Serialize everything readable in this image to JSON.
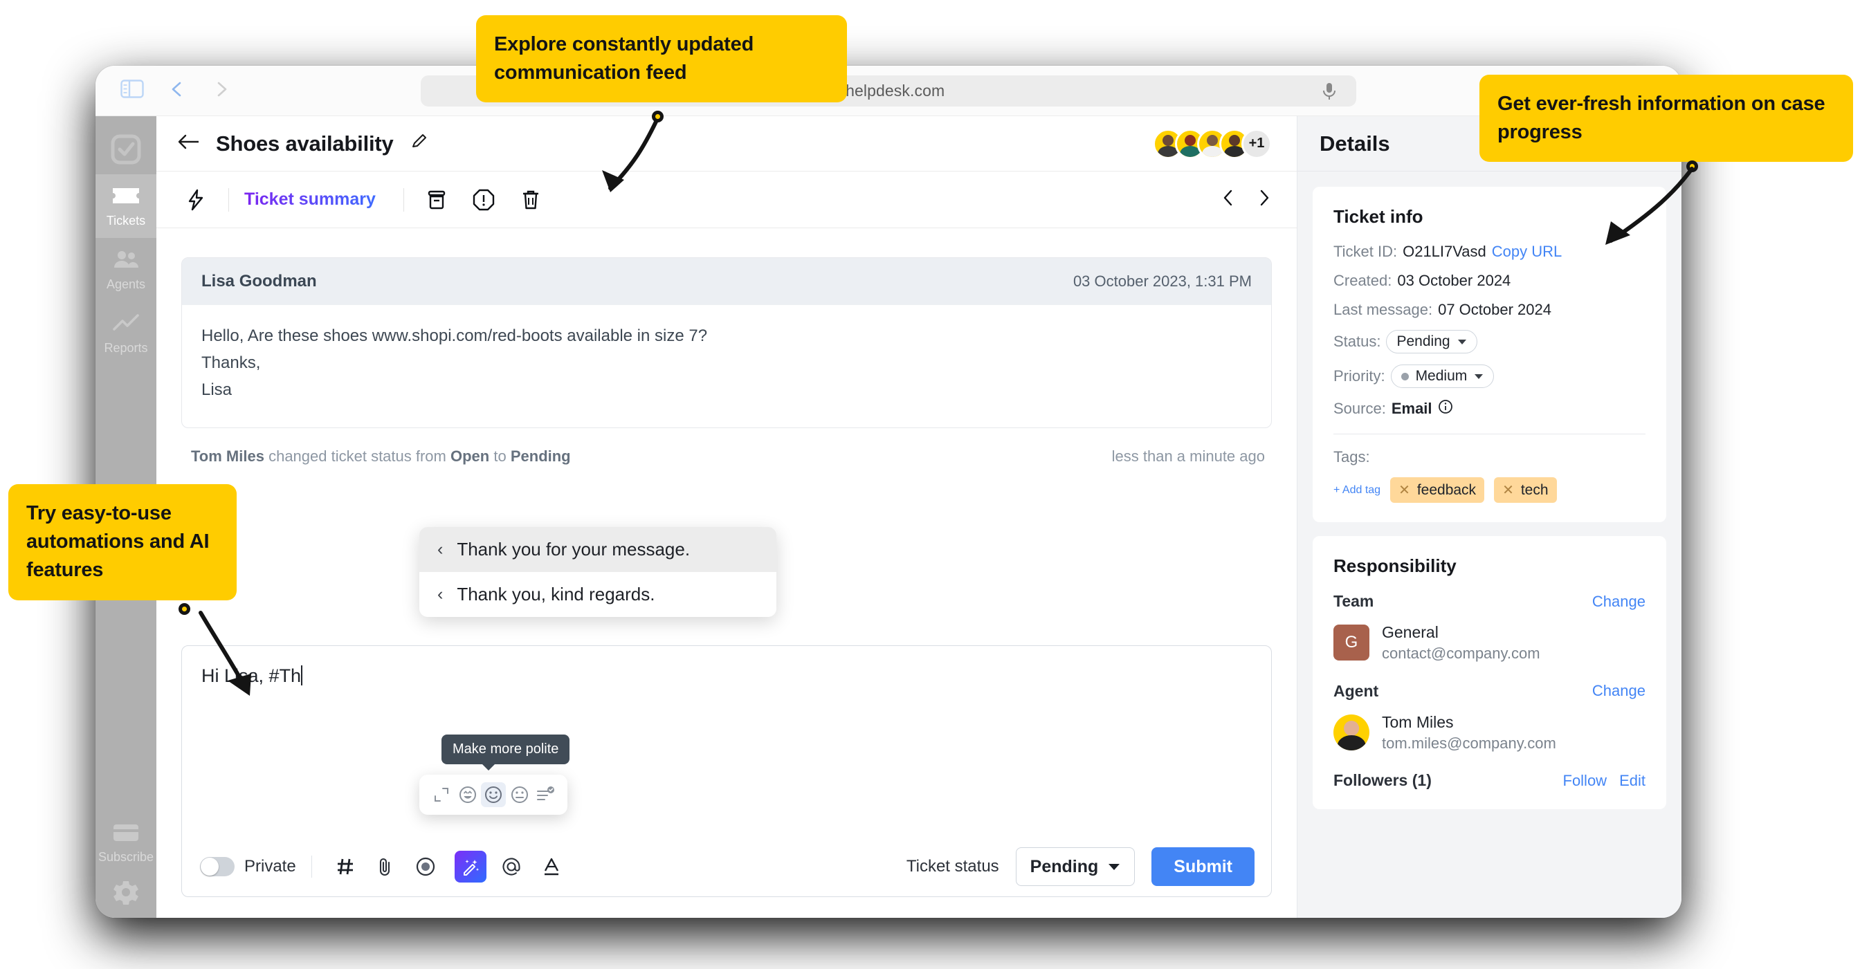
{
  "browser": {
    "url": "o.helpdesk.com",
    "sidebar_toggle_icon": "sidebar-panel-icon",
    "back_icon": "chevron-left-icon",
    "forward_icon": "chevron-right-icon",
    "mic_icon": "microphone-icon"
  },
  "sidebar": {
    "logo": "checkbox-logo-icon",
    "items": [
      {
        "label": "Tickets",
        "icon": "ticket-icon",
        "active": true
      },
      {
        "label": "Agents",
        "icon": "people-icon",
        "active": false
      },
      {
        "label": "Reports",
        "icon": "chart-line-icon",
        "active": false
      }
    ],
    "bottom": [
      {
        "label": "Subscribe",
        "icon": "credit-card-icon"
      },
      {
        "label": "",
        "icon": "gear-icon"
      }
    ]
  },
  "ticket_header": {
    "back_icon": "arrow-left-icon",
    "title": "Shoes availability",
    "edit_icon": "pencil-icon",
    "avatars_overflow": "+1",
    "avatar_count": 4
  },
  "toolbar": {
    "bolt_icon": "lightning-bolt-icon",
    "summary_label": "Ticket summary",
    "archive_icon": "archive-icon",
    "spam_icon": "exclamation-octagon-icon",
    "trash_icon": "trash-icon",
    "prev_icon": "chevron-left-icon",
    "next_icon": "chevron-right-icon"
  },
  "message": {
    "author": "Lisa Goodman",
    "date": "03 October 2023, 1:31 PM",
    "lines": [
      "Hello, Are these shoes www.shopi.com/red-boots  available in size 7?",
      "Thanks,",
      "Lisa"
    ]
  },
  "system_event": {
    "actor": "Tom Miles",
    "text_before": "changed ticket status from",
    "from_status": "Open",
    "text_middle": "to",
    "to_status": "Pending",
    "ago": "less than a minute ago"
  },
  "suggestions": {
    "caret_icon": "chevron-left-icon",
    "items": [
      {
        "text": "Thank you for your message.",
        "highlighted": true
      },
      {
        "text": "Thank you, kind regards.",
        "highlighted": false
      }
    ]
  },
  "composer": {
    "text": "Hi Lisa, #Th",
    "private_label": "Private",
    "private_on": false,
    "buttons": [
      {
        "icon": "hash-icon",
        "name": "canned-response-button"
      },
      {
        "icon": "paperclip-icon",
        "name": "attach-file-button"
      },
      {
        "icon": "record-icon",
        "name": "record-button"
      },
      {
        "icon": "magic-wand-icon",
        "name": "ai-assist-button"
      },
      {
        "icon": "at-icon",
        "name": "mention-button"
      },
      {
        "icon": "text-format-icon",
        "name": "text-format-button"
      }
    ],
    "status_label": "Ticket status",
    "status_value": "Pending",
    "submit_label": "Submit"
  },
  "ai_popover": {
    "tooltip": "Make more polite",
    "icons": [
      {
        "name": "expand-icon",
        "selected": false
      },
      {
        "name": "happy-face-icon",
        "selected": false
      },
      {
        "name": "smile-face-icon",
        "selected": true
      },
      {
        "name": "neutral-face-icon",
        "selected": false
      },
      {
        "name": "summarize-icon",
        "selected": false
      }
    ]
  },
  "details": {
    "title": "Details",
    "ticket_info": {
      "heading": "Ticket info",
      "ticket_id_label": "Ticket ID:",
      "ticket_id_value": "O21LI7Vasd",
      "copy_url_label": "Copy URL",
      "created_label": "Created:",
      "created_value": "03 October 2024",
      "last_message_label": "Last message:",
      "last_message_value": "07 October 2024",
      "status_label": "Status:",
      "status_value": "Pending",
      "priority_label": "Priority:",
      "priority_value": "Medium",
      "source_label": "Source:",
      "source_value": "Email",
      "source_info_icon": "info-circle-icon",
      "tags_label": "Tags:",
      "add_tag_label": "+ Add tag",
      "tags": [
        "feedback",
        "tech"
      ]
    },
    "responsibility": {
      "heading": "Responsibility",
      "team_label": "Team",
      "team_change": "Change",
      "team_initial": "G",
      "team_name": "General",
      "team_email": "contact@company.com",
      "agent_label": "Agent",
      "agent_change": "Change",
      "agent_name": "Tom Miles",
      "agent_email": "tom.miles@company.com",
      "followers_label": "Followers (1)",
      "follow_label": "Follow",
      "edit_label": "Edit"
    }
  },
  "callouts": [
    {
      "id": "feed",
      "text": "Explore constantly updated communication feed"
    },
    {
      "id": "progress",
      "text": "Get ever-fresh information on case progress"
    },
    {
      "id": "automations",
      "text": "Try easy-to-use automations and AI features"
    }
  ],
  "colors": {
    "callout_yellow": "#ffcc00",
    "accent_blue": "#4385f5",
    "ai_purple": "#7b2ff7",
    "tag_orange": "#ffd89a",
    "sidebar_grey": "#b0b0b0"
  }
}
